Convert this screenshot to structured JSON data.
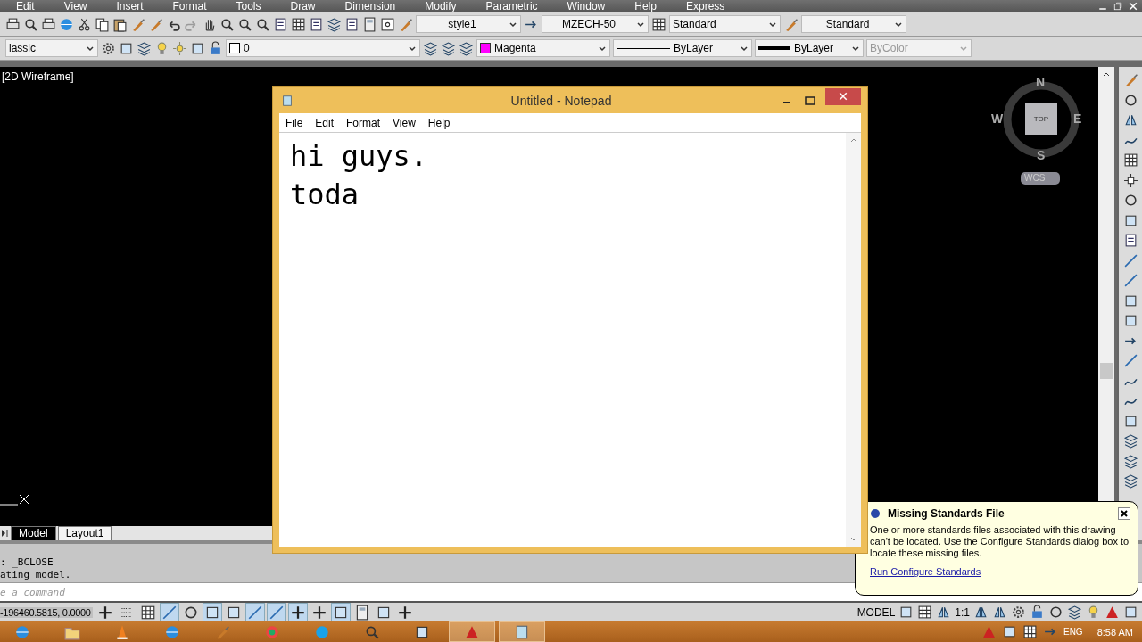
{
  "menu_bar": {
    "items": [
      "Edit",
      "View",
      "Insert",
      "Format",
      "Tools",
      "Draw",
      "Dimension",
      "Modify",
      "Parametric",
      "Window",
      "Help",
      "Express"
    ]
  },
  "toolbar": {
    "text_style": "style1",
    "dim_style": "MZECH-50",
    "table_style": "Standard",
    "multileader_style": "Standard"
  },
  "properties_bar": {
    "workspace": "lassic",
    "layer": "0",
    "color": {
      "label": "Magenta",
      "color": "#ff00ff"
    },
    "linetype": "ByLayer",
    "lineweight": "ByLayer",
    "plot_style": {
      "label": "ByColor",
      "disabled": true
    }
  },
  "viewport_label": "[2D Wireframe]",
  "viewcube": {
    "north": "N",
    "west": "W",
    "east": "E",
    "south": "S",
    "face": "TOP",
    "ucs": "WCS"
  },
  "layout_tabs": [
    {
      "label": "Model",
      "selected": true
    },
    {
      "label": "Layout1",
      "selected": false
    }
  ],
  "command_history": [
    ": _BCLOSE",
    "ating model."
  ],
  "command_line": {
    "placeholder": "e a command"
  },
  "status_bar": {
    "coordinates": "-196460.5815, 0.0000",
    "toggles": [
      {
        "on": false
      },
      {
        "on": false
      },
      {
        "on": false
      },
      {
        "on": true
      },
      {
        "on": false
      },
      {
        "on": true
      },
      {
        "on": false
      },
      {
        "on": true
      },
      {
        "on": true
      },
      {
        "on": true
      },
      {
        "on": false
      },
      {
        "on": true
      },
      {
        "on": false
      },
      {
        "on": false
      },
      {
        "on": false
      }
    ],
    "space": "MODEL",
    "scale": "1:1"
  },
  "notepad": {
    "title": "Untitled - Notepad",
    "menu": [
      "File",
      "Edit",
      "Format",
      "View",
      "Help"
    ],
    "lines": [
      "hi guys.",
      "toda"
    ]
  },
  "notification": {
    "title": "Missing Standards File",
    "message": "One or more standards files associated with this drawing can't be located. Use the Configure Standards dialog box to locate these missing files.",
    "link": "Run Configure Standards"
  },
  "taskbar": {
    "apps": [
      {
        "selected": false
      },
      {
        "selected": false
      },
      {
        "selected": false
      },
      {
        "selected": false
      },
      {
        "selected": false
      },
      {
        "selected": false
      },
      {
        "selected": false
      },
      {
        "selected": false
      },
      {
        "selected": false
      },
      {
        "selected": true
      },
      {
        "selected": true
      }
    ],
    "language": "ENG",
    "time": "8:58 AM"
  }
}
